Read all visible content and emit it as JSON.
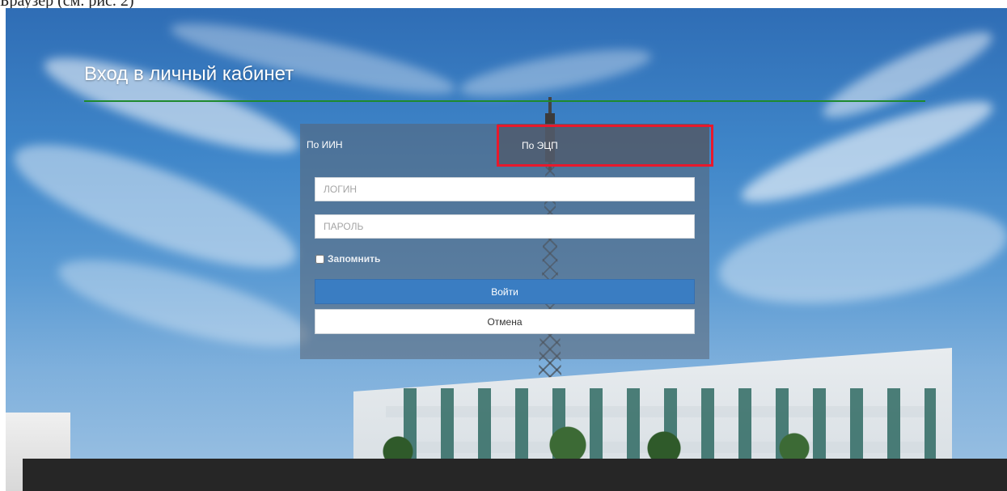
{
  "caption": "Браузер (см. рис. 2)",
  "page": {
    "title": "Вход в личный кабинет",
    "accent_color": "#1e8a2e",
    "highlight_color": "#e8192c"
  },
  "tabs": [
    {
      "label": "По ИИН",
      "active": true
    },
    {
      "label": "По ЭЦП",
      "active": false
    }
  ],
  "form": {
    "login_placeholder": "ЛОГИН",
    "password_placeholder": "ПАРОЛЬ",
    "remember_label": "Запомнить",
    "remember_checked": false,
    "submit_label": "Войти",
    "cancel_label": "Отмена"
  }
}
